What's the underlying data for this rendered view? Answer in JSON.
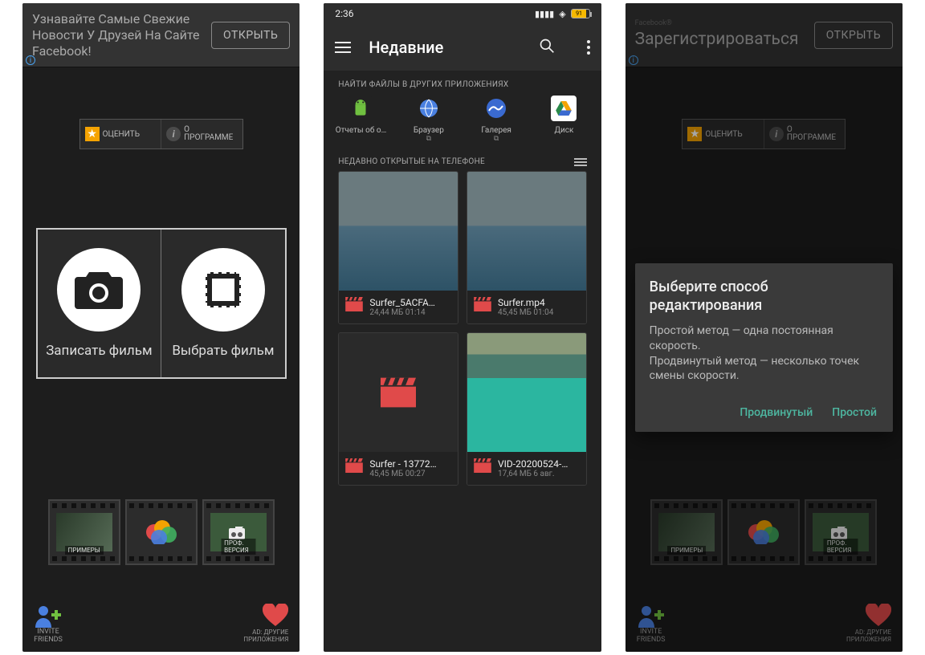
{
  "screen1": {
    "ad": {
      "text": "Узнавайте Самые Свежие Новости У Друзей На Сайте Facebook!",
      "open": "ОТКРЫТЬ"
    },
    "rate_label": "ОЦЕНИТЬ",
    "about_line1": "О",
    "about_line2": "ПРОГРАММЕ",
    "record_label": "Записать фильм",
    "pick_label": "Выбрать фильм",
    "film": {
      "examples": "ПРИМЕРЫ",
      "pro": "ПРОФ. ВЕРСИЯ"
    },
    "invite_line1": "INVITE",
    "invite_line2": "FRIENDS",
    "other_line1": "AD: ДРУГИЕ",
    "other_line2": "ПРИЛОЖЕНИЯ"
  },
  "screen2": {
    "time": "2:36",
    "battery": "91",
    "title": "Недавние",
    "find_apps_label": "НАЙТИ ФАЙЛЫ В ДРУГИХ ПРИЛОЖЕНИЯХ",
    "sources": [
      {
        "name": "Отчеты об о…"
      },
      {
        "name": "Браузер"
      },
      {
        "name": "Галерея"
      },
      {
        "name": "Диск"
      }
    ],
    "recent_label": "НЕДАВНО ОТКРЫТЫЕ НА ТЕЛЕФОНЕ",
    "files": [
      {
        "name": "Surfer_5ACFA…",
        "info": "24,44 МБ 01:14",
        "thumb": "ocean"
      },
      {
        "name": "Surfer.mp4",
        "info": "45,45 МБ 01:04",
        "thumb": "ocean"
      },
      {
        "name": "Surfer - 13772…",
        "info": "45,45 МБ 00:27",
        "thumb": "none"
      },
      {
        "name": "VID-20200524-…",
        "info": "17,64 МБ 6 авг.",
        "thumb": "lagoon"
      }
    ]
  },
  "screen3": {
    "ad": {
      "brand": "Facebook®",
      "text": "Зарегистрироваться",
      "open": "ОТКРЫТЬ"
    },
    "dialog": {
      "title": "Выберите способ редактирования",
      "body1": "Простой метод — одна постоянная скорость.",
      "body2": "Продвинутый метод — несколько точек смены скорости.",
      "advanced": "Продвинутый",
      "simple": "Простой"
    }
  }
}
